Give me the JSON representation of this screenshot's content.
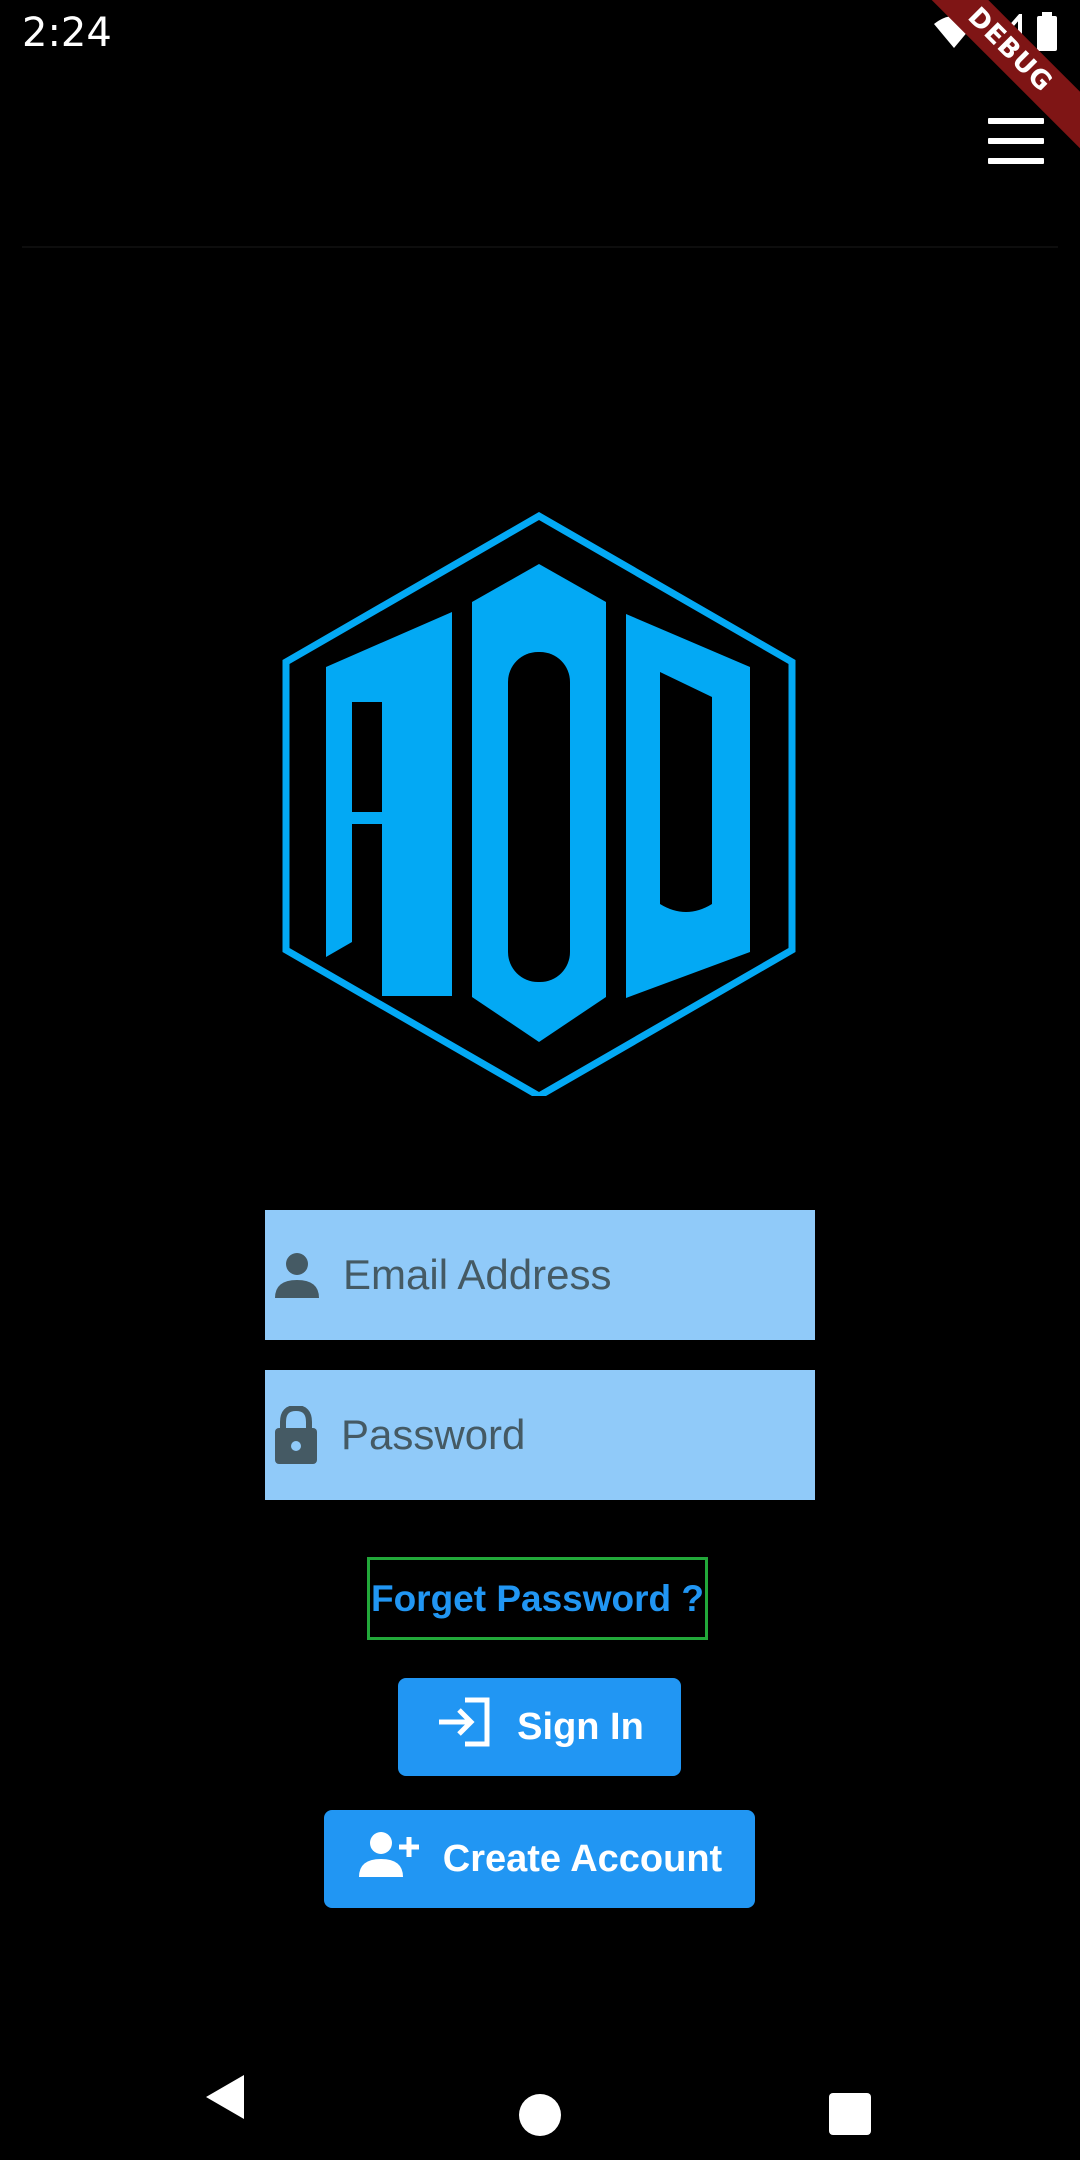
{
  "status_bar": {
    "time": "2:24",
    "icons": [
      "wifi-icon",
      "cell-signal-icon",
      "battery-icon"
    ],
    "debug_label": "DEBUG"
  },
  "app_bar": {
    "menu_icon": "menu-icon"
  },
  "logo": {
    "text": "ADU",
    "color": "#03a9f4"
  },
  "form": {
    "email": {
      "placeholder": "Email Address",
      "value": "",
      "icon": "person-icon"
    },
    "password": {
      "placeholder": "Password",
      "value": "",
      "icon": "lock-icon"
    },
    "forget_password_label": "Forget Password ?"
  },
  "buttons": {
    "sign_in": {
      "label": "Sign In",
      "icon": "login-icon"
    },
    "create_account": {
      "label": "Create Account",
      "icon": "person-add-icon"
    }
  },
  "nav_bar": {
    "icons": [
      "back-icon",
      "home-icon",
      "recents-icon"
    ]
  },
  "colors": {
    "background": "#000000",
    "field_background": "#90caf9",
    "accent": "#2196f3",
    "forget_border": "#22a83a",
    "debug_banner": "#7f1515"
  }
}
